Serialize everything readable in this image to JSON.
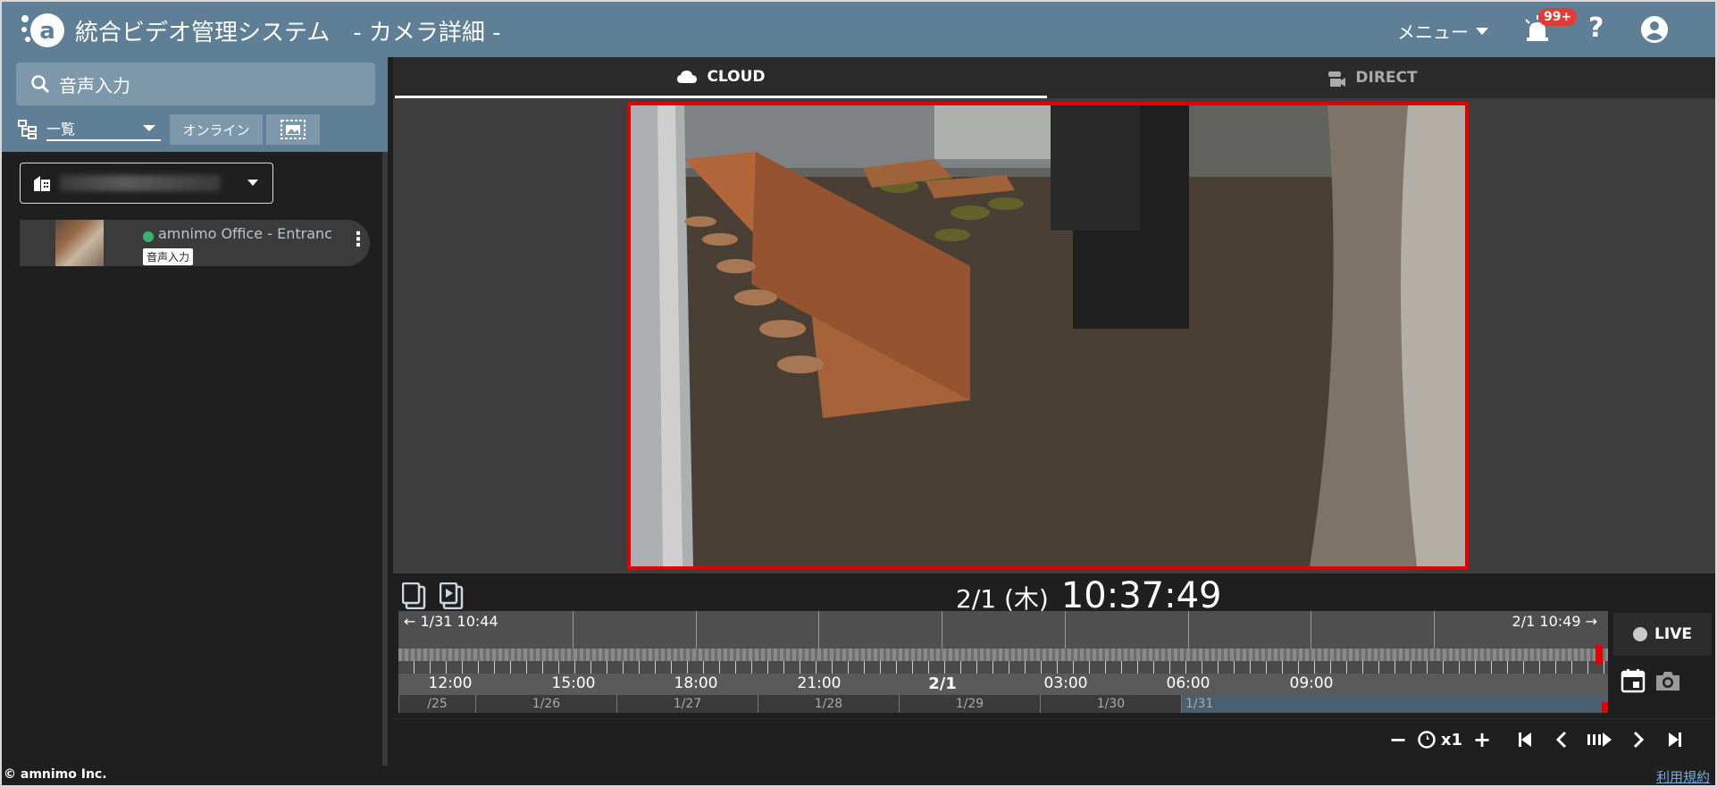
{
  "header": {
    "app_title": "統合ビデオ管理システム",
    "page_subtitle": "- カメラ詳細 -",
    "menu_label": "メニュー",
    "notification_badge": "99+",
    "help_label": "?"
  },
  "sidebar": {
    "search_value": "音声入力",
    "view_select": "一覧",
    "online_filter": "オンライン",
    "camera": {
      "name": "amnimo Office - Entranc",
      "tag": "音声入力",
      "status_color": "#3cb371"
    }
  },
  "tabs": [
    {
      "label": "CLOUD",
      "active": true
    },
    {
      "label": "DIRECT",
      "active": false
    }
  ],
  "player": {
    "date": "2/1 (木)",
    "time": "10:37:49",
    "range_start": "1/31 10:44",
    "range_end": "2/1 10:49",
    "hours": [
      "12:00",
      "15:00",
      "18:00",
      "21:00",
      "2/1",
      "03:00",
      "06:00",
      "09:00"
    ],
    "days": [
      "/25",
      "1/26",
      "1/27",
      "1/28",
      "1/29",
      "1/30",
      "1/31"
    ],
    "live_label": "LIVE",
    "speed": "x1",
    "minus": "−",
    "plus": "+"
  },
  "footer": {
    "copyright": "© amnimo Inc.",
    "terms": "利用規約"
  },
  "colors": {
    "header_bg": "#5f7f97",
    "video_border": "#e00000",
    "accent_red": "#e53935"
  }
}
